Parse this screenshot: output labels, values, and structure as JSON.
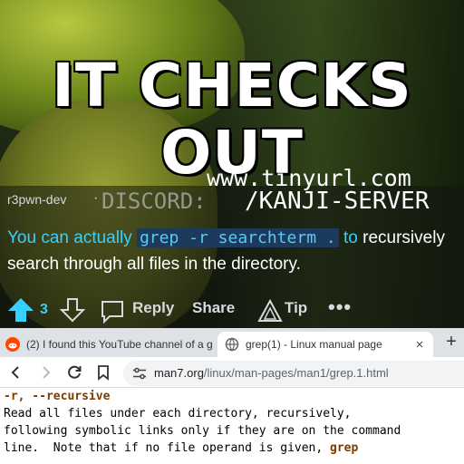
{
  "meme": {
    "headline": "IT CHECKS OUT",
    "url_line": "www.tinyurl.com",
    "discord_label": "DISCORD:",
    "server_path": "/KANJI-SERVER"
  },
  "comment": {
    "username": "r3pwn-dev",
    "separator": "·",
    "lead": "You can actually",
    "code": "grep -r searchterm .",
    "to": "to",
    "rest": "recursively search through all files in the directory.",
    "votes": "3",
    "reply_label": "Reply",
    "share_label": "Share",
    "tip_label": "Tip",
    "more_label": "•••"
  },
  "browser": {
    "tabs": [
      {
        "title": "(2) I found this YouTube channel of a g",
        "favicon": "reddit-icon"
      },
      {
        "title": "grep(1) - Linux manual page",
        "favicon": "globe-icon",
        "close": "×"
      }
    ],
    "new_tab": "+",
    "address": {
      "domain": "man7.org",
      "path": "/linux/man-pages/man1/grep.1.html"
    }
  },
  "man": {
    "option": "-r, --recursive",
    "line1": "Read all files under each directory, recursively,",
    "line2": "following symbolic links only if they are on the command",
    "line3": "line.  Note that if no file operand is given, ",
    "line3_cmd": "grep"
  },
  "colors": {
    "highlight": "#36d1ff",
    "code_bg": "#1b3a5c",
    "tabbar": "#dee1e6",
    "man_option": "#7a3b00"
  }
}
